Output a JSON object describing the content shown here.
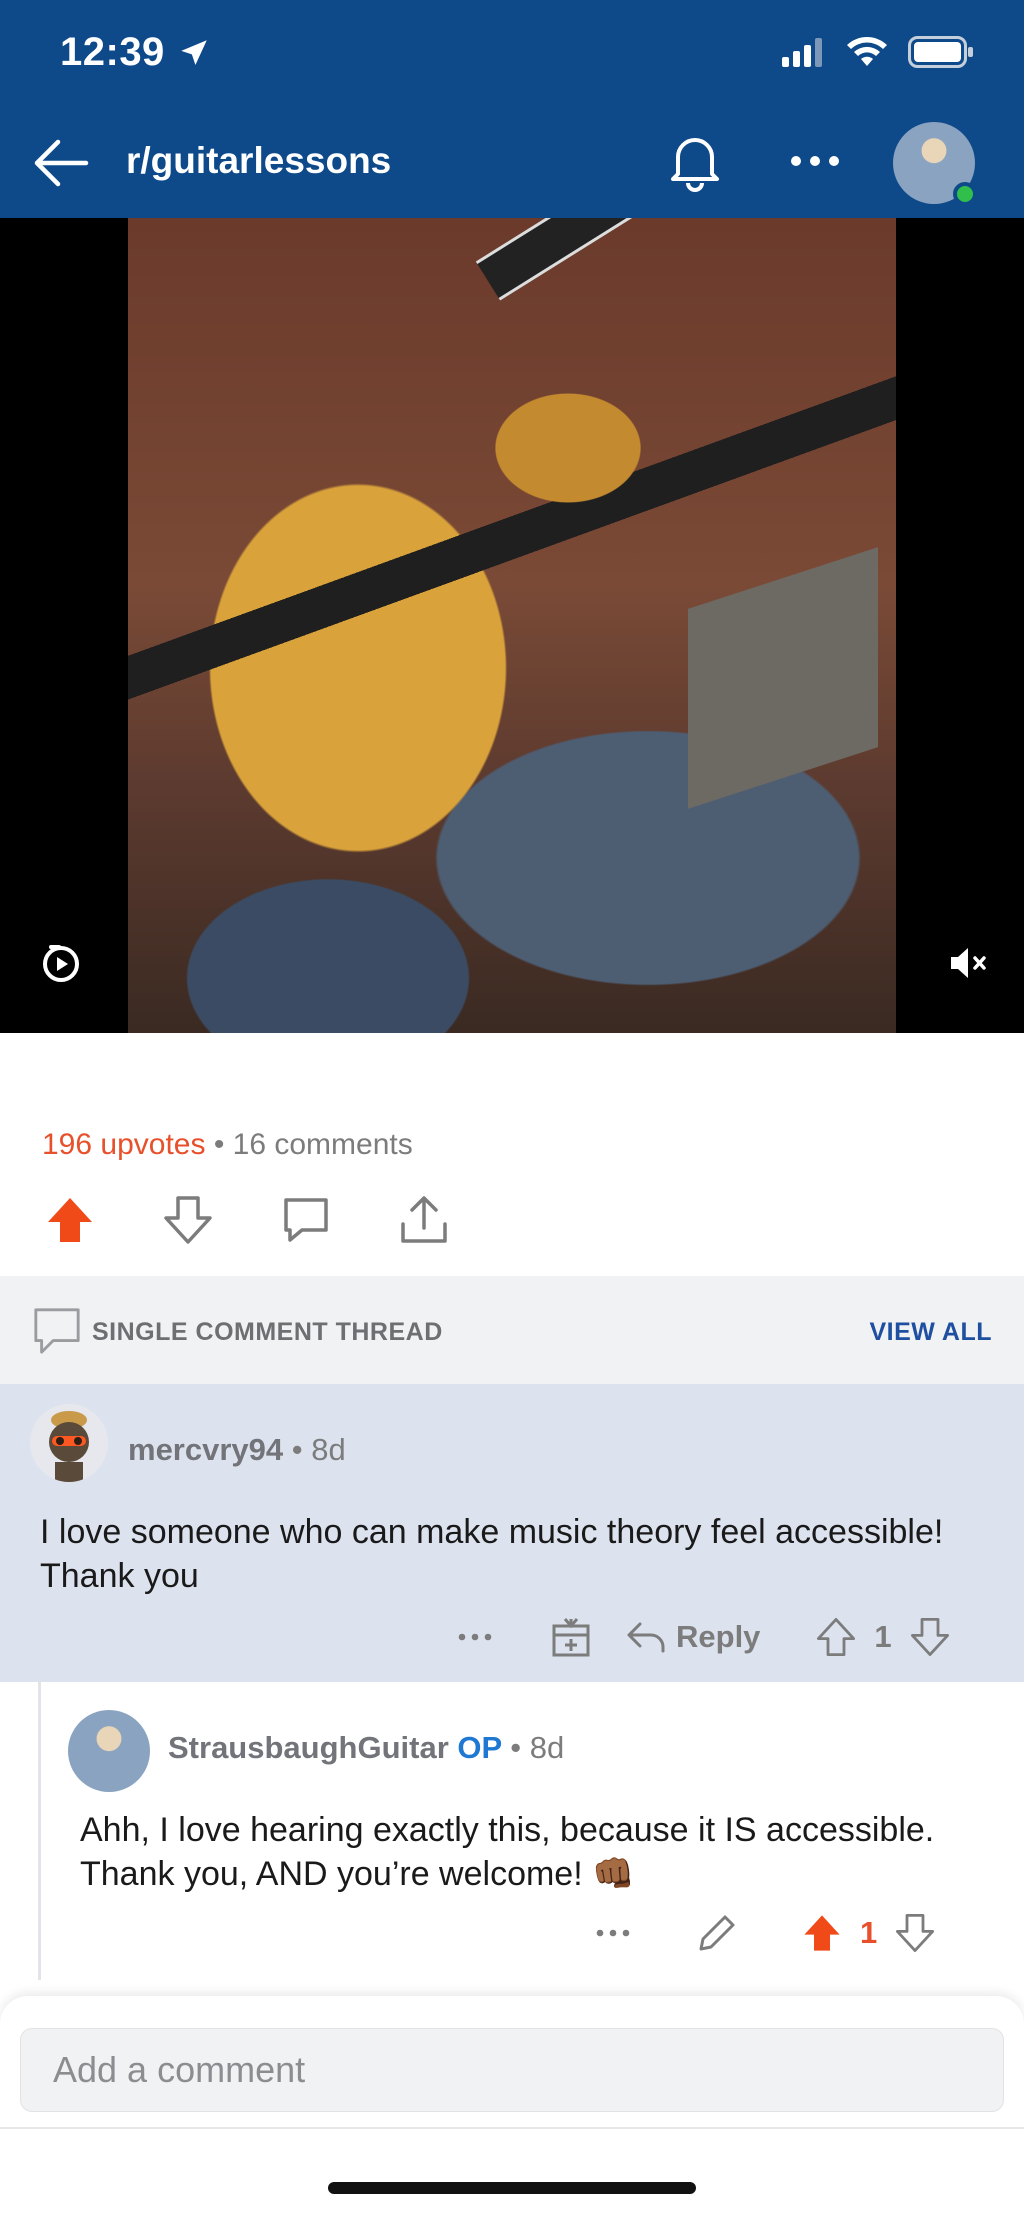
{
  "status_bar": {
    "time": "12:39"
  },
  "nav": {
    "subreddit": "r/guitarlessons"
  },
  "post": {
    "upvotes": "196 upvotes",
    "separator": "•",
    "comments": "16 comments"
  },
  "thread": {
    "label": "SINGLE COMMENT THREAD",
    "view_all": "VIEW ALL"
  },
  "comments": [
    {
      "username": "mercvry94",
      "time": "8d",
      "body": "I love someone who can make music theory feel accessible! Thank you",
      "reply_label": "Reply",
      "score": "1"
    },
    {
      "username": "StrausbaughGuitar",
      "badge": "OP",
      "time": "8d",
      "body": "Ahh, I love hearing exactly this, because it IS accessible. Thank you, AND you’re welcome! 👊🏾",
      "score": "1"
    }
  ],
  "composer": {
    "placeholder": "Add a comment"
  },
  "colors": {
    "header": "#0e4a8a",
    "upvote": "#e8502b",
    "view_all": "#1f4fa0",
    "op_badge": "#1f78d1"
  }
}
